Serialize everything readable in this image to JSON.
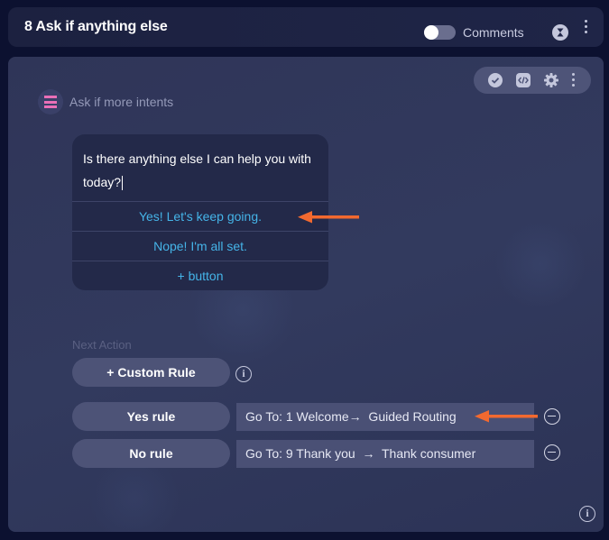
{
  "header": {
    "title": "8 Ask if anything else",
    "comments_label": "Comments",
    "comments_toggle_on": false
  },
  "toolbar": {
    "icons": [
      "check-circle-icon",
      "code-icon",
      "gear-icon",
      "more-vertical-icon"
    ]
  },
  "step": {
    "icon": "menu-lines-icon",
    "label": "Ask if more intents"
  },
  "message_card": {
    "text": "Is there anything else I can help you with today?",
    "buttons": [
      {
        "label": "Yes! Let's keep going."
      },
      {
        "label": "Nope! I'm all set."
      },
      {
        "label": "+ button"
      }
    ]
  },
  "next_action": {
    "label": "Next Action",
    "custom_rule_label": "+ Custom Rule",
    "rules": [
      {
        "name": "Yes rule",
        "goto": "Go To: 1 Welcome→  Guided Routing"
      },
      {
        "name": "No rule",
        "goto": "Go To: 9 Thank you  →  Thank consumer"
      }
    ]
  },
  "colors": {
    "accent_link": "#45b4e8",
    "annotation_arrow": "#f2692f",
    "step_icon": "#ea6fb7"
  }
}
